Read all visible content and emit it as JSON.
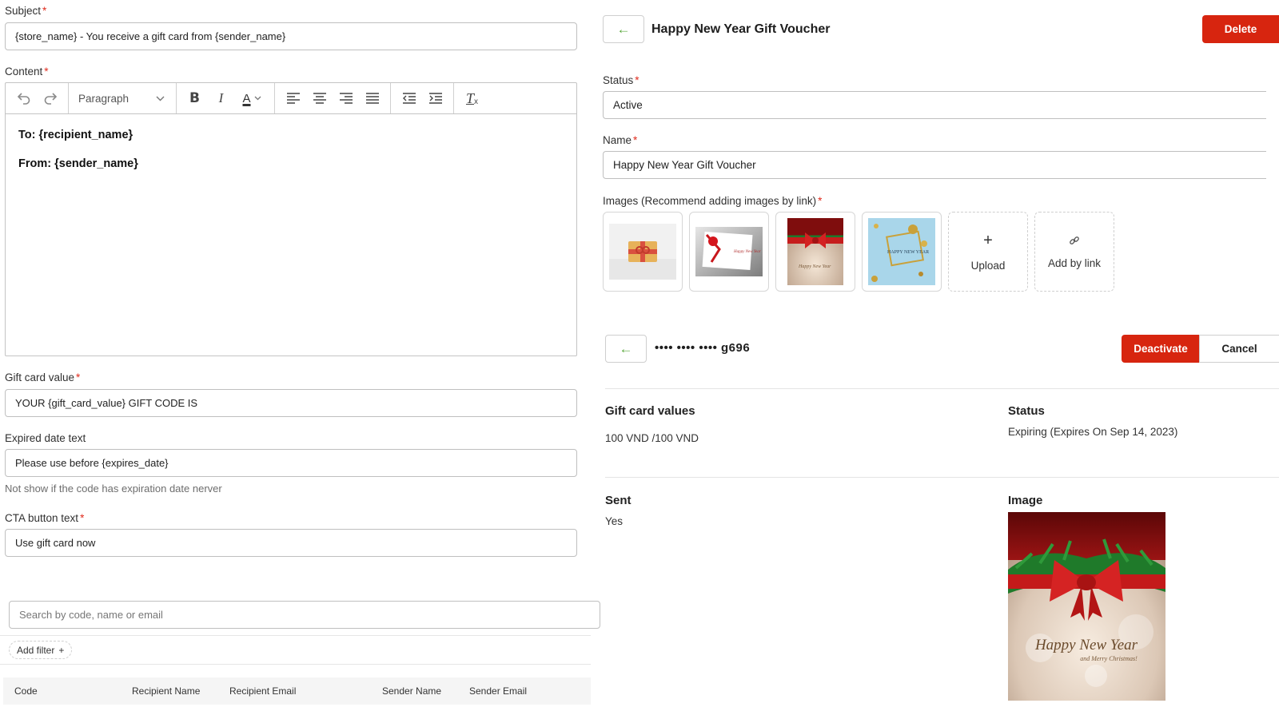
{
  "email_form": {
    "subject": {
      "label": "Subject",
      "required_mark": "*",
      "value": "{store_name} - You receive a gift card from {sender_name}"
    },
    "content": {
      "label": "Content",
      "required_mark": "*",
      "toolbar": {
        "undo_icon": "undo-icon",
        "redo_icon": "redo-icon",
        "block_format": "Paragraph",
        "bold": "B",
        "italic": "I",
        "text_color": "A",
        "clear_format": "T"
      },
      "body_lines": [
        "To: {recipient_name}",
        "From: {sender_name}"
      ]
    },
    "gift_card_value": {
      "label": "Gift card value",
      "required_mark": "*",
      "value": "YOUR {gift_card_value} GIFT CODE IS"
    },
    "expired_date_text": {
      "label": "Expired date text",
      "value": "Please use before {expires_date}",
      "hint": "Not show if the code has expiration date nerver"
    },
    "cta_button_text": {
      "label": "CTA button text",
      "required_mark": "*",
      "value": "Use gift card now"
    }
  },
  "codes_list": {
    "search_placeholder": "Search by code, name or email",
    "add_filter": "Add filter",
    "add_filter_icon": "+",
    "columns": [
      "Code",
      "Recipient Name",
      "Recipient Email",
      "Sender Name",
      "Sender Email"
    ]
  },
  "voucher": {
    "back_icon": "←",
    "title": "Happy New Year Gift Voucher",
    "delete_label": "Delete",
    "status": {
      "label": "Status",
      "required_mark": "*",
      "value": "Active"
    },
    "name": {
      "label": "Name",
      "required_mark": "*",
      "value": "Happy New Year Gift Voucher"
    },
    "images": {
      "label": "Images (Recommend adding images by link)",
      "required_mark": "*",
      "upload_label": "Upload",
      "upload_icon": "+",
      "add_by_link_label": "Add by link",
      "add_by_link_icon": "link-icon",
      "thumb_texts": [
        "Happy New Year",
        "HAPPY NEW YEAR"
      ]
    }
  },
  "gift_code": {
    "back_icon": "←",
    "masked_code": "•••• •••• •••• g696",
    "deactivate_label": "Deactivate",
    "cancel_label": "Cancel",
    "values": {
      "label": "Gift card values",
      "value": "100 VND /100 VND"
    },
    "status": {
      "label": "Status",
      "value": "Expiring (Expires On Sep 14, 2023)"
    },
    "sent": {
      "label": "Sent",
      "value": "Yes"
    },
    "image": {
      "label": "Image",
      "script_line1": "Happy New Year",
      "script_line2": "and Merry Christmas!"
    }
  },
  "colors": {
    "accent_red": "#d7250f",
    "back_arrow_green": "#5aa83d",
    "required_red": "#e02b1d"
  }
}
